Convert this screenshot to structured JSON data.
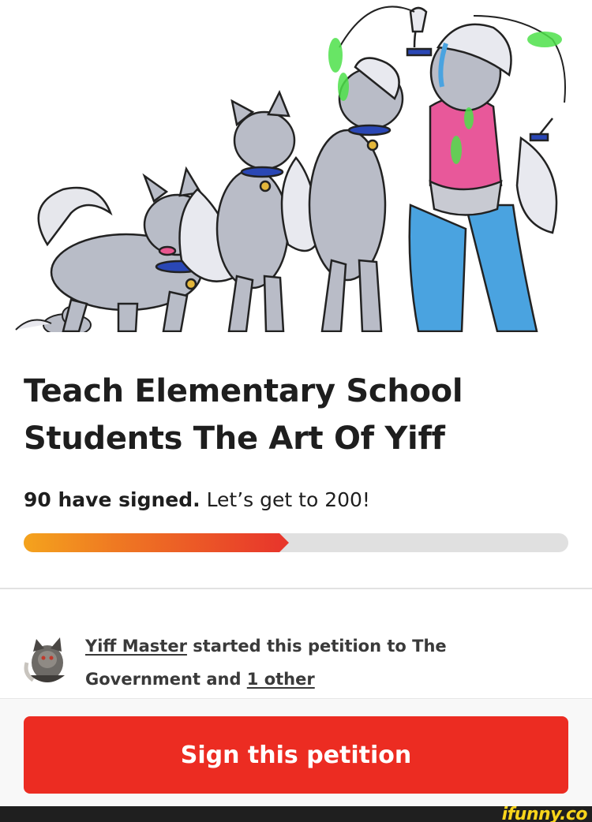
{
  "petition": {
    "title": "Teach Elementary School Students The Art Of Yiff",
    "signed_strong": "90 have signed.",
    "signed_goal": "Let’s get to 200!",
    "signed_count": 90,
    "goal": 200,
    "progress_fraction": 0.47
  },
  "starter": {
    "name": "Yiff Master",
    "text_mid": "started this petition to",
    "recipient": "The Government",
    "and": "and",
    "others_link": "1 other"
  },
  "actions": {
    "sign_label": "Sign this petition"
  },
  "colors": {
    "accent_red": "#ec2c22",
    "progress_start": "#f4a31d",
    "progress_end": "#e8372b"
  },
  "watermark": "ifunny.co"
}
